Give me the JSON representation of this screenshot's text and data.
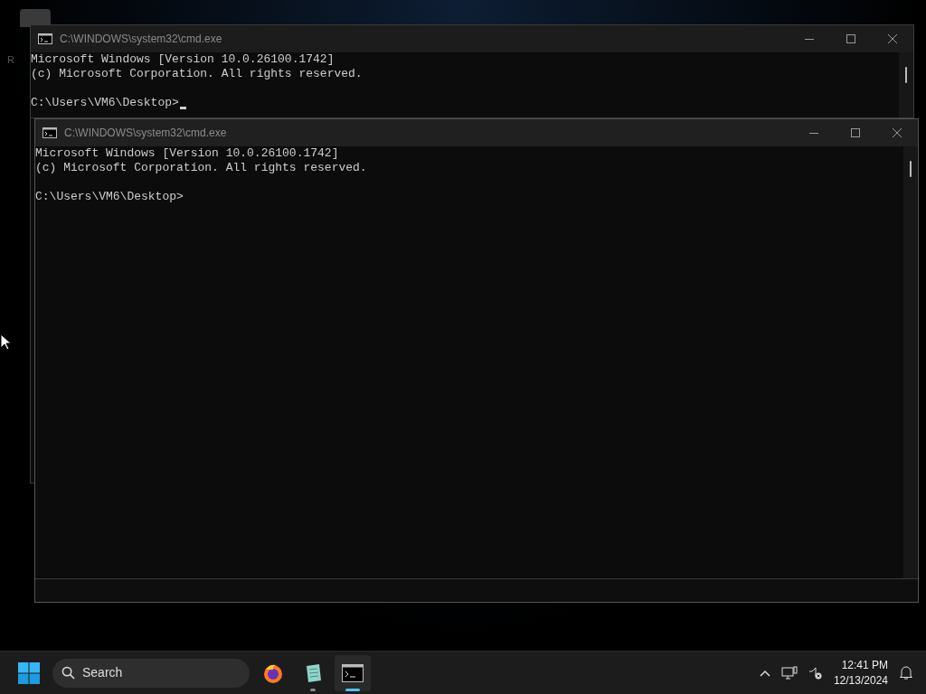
{
  "desktop": {
    "icon_label": "R"
  },
  "windows": [
    {
      "title": "C:\\WINDOWS\\system32\\cmd.exe",
      "banner": [
        "Microsoft Windows [Version 10.0.26100.1742]",
        "(c) Microsoft Corporation. All rights reserved."
      ],
      "prompt": "C:\\Users\\VM6\\Desktop>",
      "cursor": true,
      "focused": false
    },
    {
      "title": "C:\\WINDOWS\\system32\\cmd.exe",
      "banner": [
        "Microsoft Windows [Version 10.0.26100.1742]",
        "(c) Microsoft Corporation. All rights reserved."
      ],
      "prompt": "C:\\Users\\VM6\\Desktop>",
      "cursor": false,
      "focused": true
    }
  ],
  "taskbar": {
    "search": {
      "placeholder": "Search"
    },
    "apps": [
      {
        "kind": "browser",
        "running": false,
        "active": false
      },
      {
        "kind": "notepad",
        "running": true,
        "active": false
      },
      {
        "kind": "terminal",
        "running": true,
        "active": true
      }
    ],
    "clock": {
      "time": "12:41 PM",
      "date": "12/13/2024"
    }
  }
}
